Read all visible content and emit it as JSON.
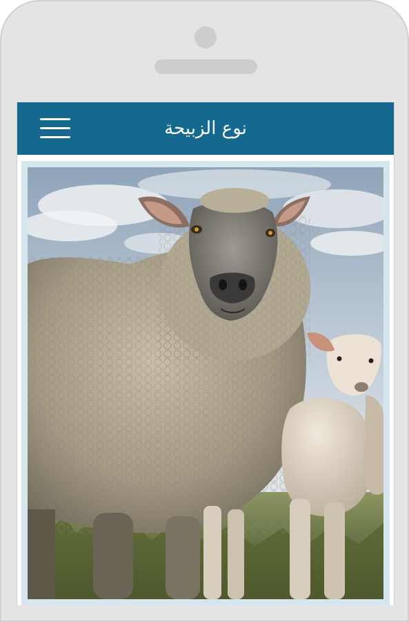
{
  "app_bar": {
    "title": "نوع الزبيحة",
    "menu_icon": "hamburger-menu-icon",
    "background_color": "#15698f"
  },
  "content": {
    "image_subject": "sheep-and-lamb-photo",
    "card_border_color": "#d6e6ee"
  },
  "device": {
    "frame_color": "#e4e4e4"
  }
}
